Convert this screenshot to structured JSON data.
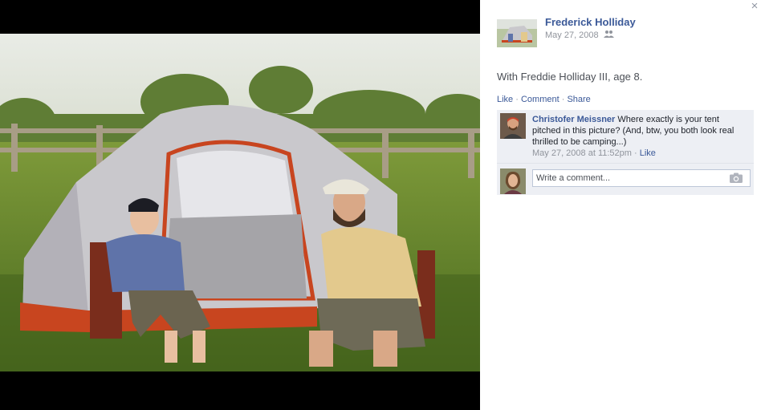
{
  "photo": {
    "alt": "Man and boy sitting in camping chairs in front of a grey and red tent on grass"
  },
  "header": {
    "close_label": "×",
    "author": "Frederick Holliday",
    "date": "May 27, 2008",
    "audience_icon": "friends-icon"
  },
  "caption": "With Freddie Holliday III, age 8.",
  "actions": {
    "like": "Like",
    "sep1": " · ",
    "comment": "Comment",
    "sep2": " · ",
    "share": "Share"
  },
  "comments": [
    {
      "author": "Christofer Meissner",
      "text": " Where exactly is your tent pitched in this picture? (And, btw, you both look real thrilled to be camping...)",
      "time": "May 27, 2008 at 11:52pm",
      "sep": " · ",
      "like": "Like"
    }
  ],
  "composer": {
    "placeholder": "Write a comment...",
    "camera_icon": "camera-icon"
  },
  "colors": {
    "link": "#3b5998",
    "meta": "#90949c",
    "comment_bg": "#edeff4",
    "tent_grey": "#c9c8cc",
    "tent_red": "#c8451f"
  }
}
